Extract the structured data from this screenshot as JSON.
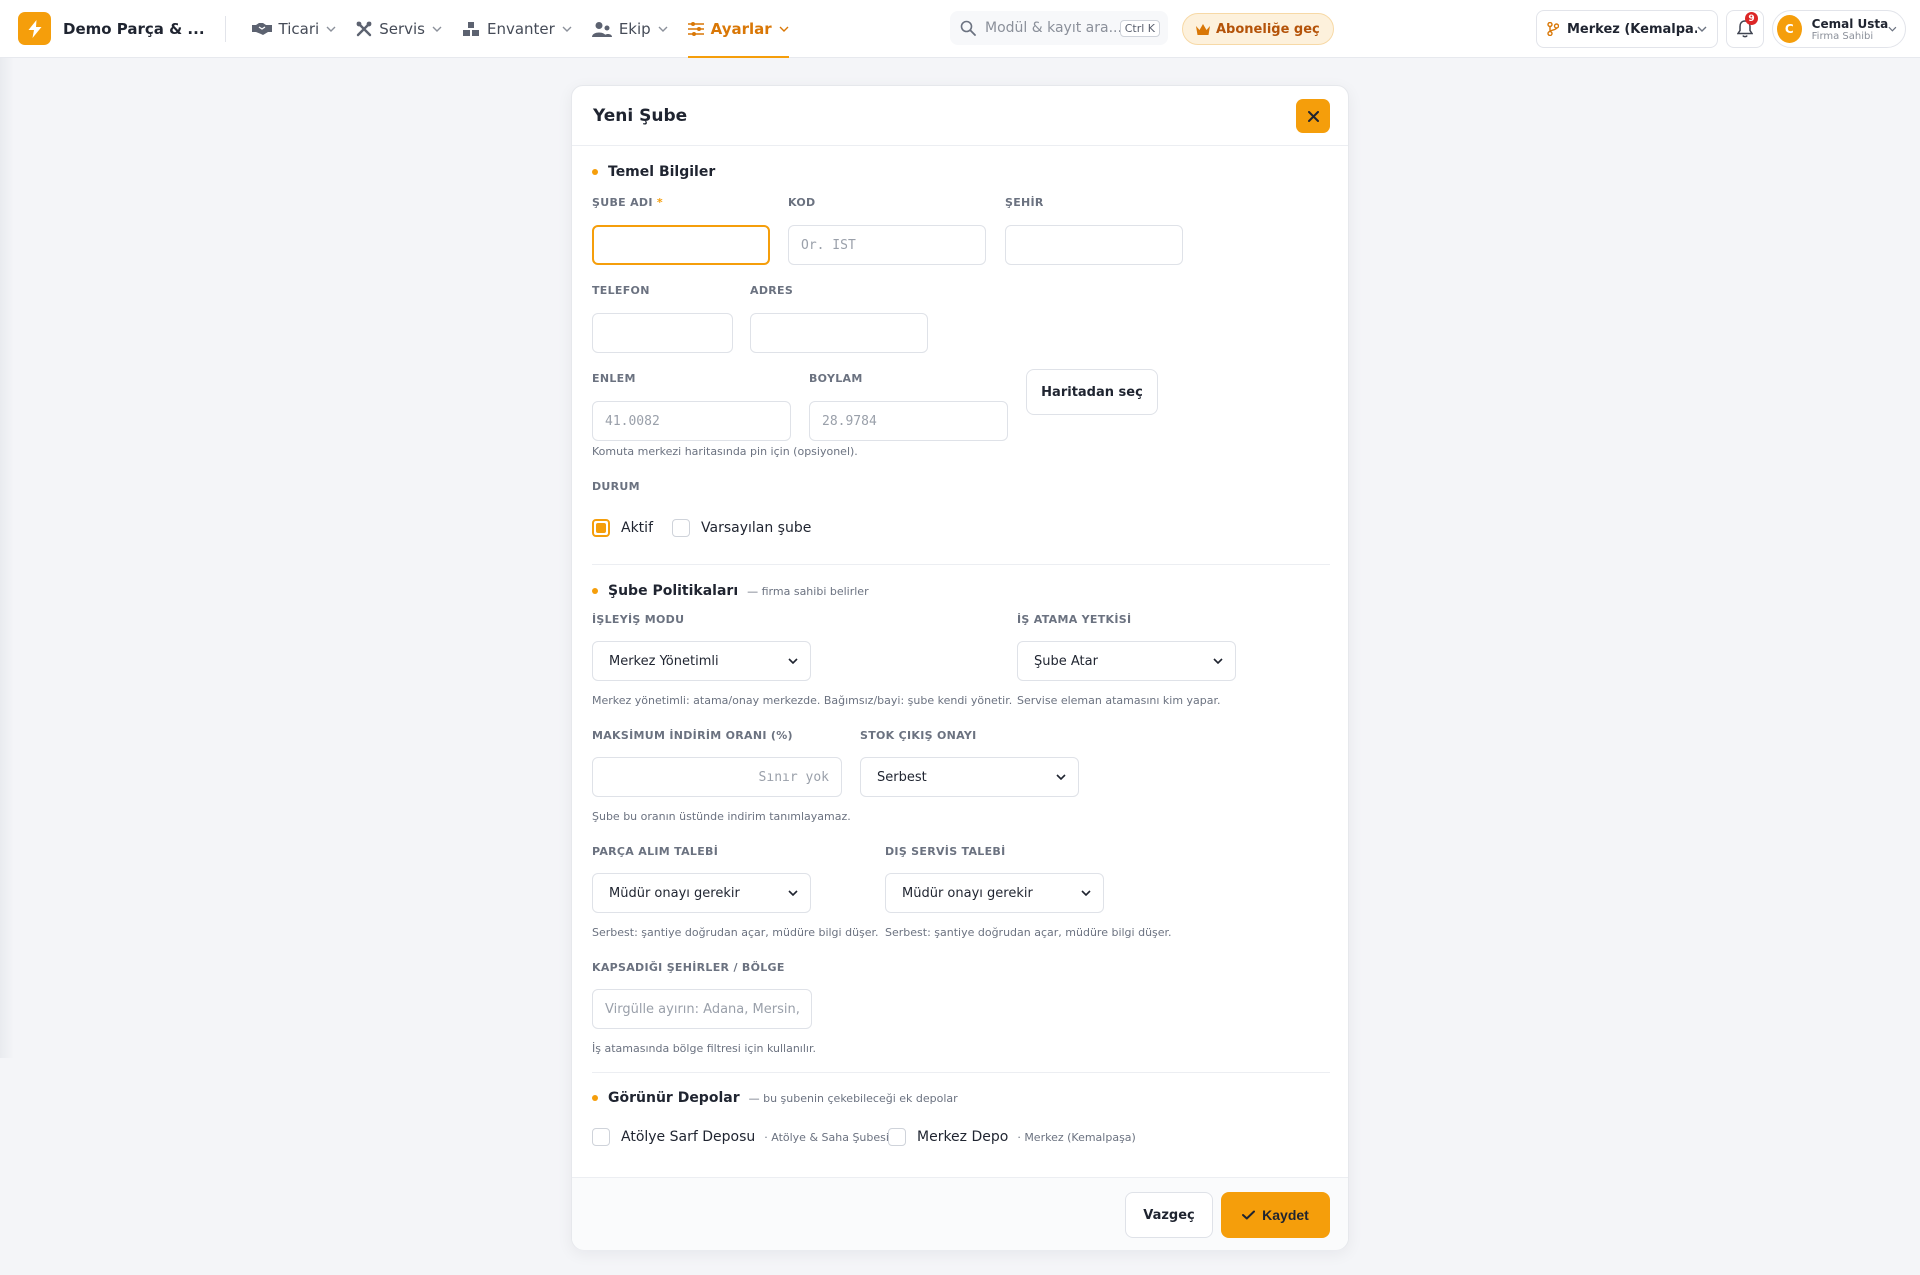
{
  "brand": {
    "name": "Demo Parça & ..."
  },
  "nav": [
    {
      "label": "Ticari",
      "icon": "handshake-icon"
    },
    {
      "label": "Servis",
      "icon": "tools-icon"
    },
    {
      "label": "Envanter",
      "icon": "warehouse-icon"
    },
    {
      "label": "Ekip",
      "icon": "team-icon"
    },
    {
      "label": "Ayarlar",
      "icon": "sliders-icon",
      "active": true
    }
  ],
  "search": {
    "placeholder": "Modül & kayıt ara...",
    "shortcut": "Ctrl K"
  },
  "subscribe": {
    "label": "Aboneliğe geç"
  },
  "branch": {
    "label": "Merkez (Kemalpa..."
  },
  "notifications": {
    "count": "9"
  },
  "user": {
    "initial": "C",
    "name": "Cemal Usta",
    "role": "Firma Sahibi"
  },
  "modal": {
    "title": "Yeni Şube",
    "basic": {
      "title": "Temel Bilgiler",
      "branch_name_label": "ŞUBE ADI",
      "branch_name_required": "*",
      "branch_name_value": "",
      "code_label": "KOD",
      "code_placeholder": "Ör. IST",
      "city_label": "ŞEHİR",
      "city_value": "",
      "phone_label": "TELEFON",
      "phone_value": "",
      "address_label": "ADRES",
      "address_value": "",
      "lat_label": "ENLEM",
      "lat_placeholder": "41.0082",
      "lng_label": "BOYLAM",
      "lng_placeholder": "28.9784",
      "map_button": "Haritadan seç",
      "coords_hint": "Komuta merkezi haritasında pin için (opsiyonel).",
      "status_label": "DURUM",
      "active_label": "Aktif",
      "active_checked": true,
      "default_label": "Varsayılan şube",
      "default_checked": false
    },
    "policies": {
      "title": "Şube Politikaları",
      "subtitle": "— firma sahibi belirler",
      "operation_mode_label": "İŞLEYİŞ MODU",
      "operation_mode_value": "Merkez Yönetimli",
      "operation_mode_hint": "Merkez yönetimli: atama/onay merkezde. Bağımsız/bayi: şube kendi yönetir.",
      "assign_label": "İŞ ATAMA YETKİSİ",
      "assign_value": "Şube Atar",
      "assign_hint": "Servise eleman atamasını kim yapar.",
      "max_discount_label": "MAKSİMUM İNDİRİM ORANI (%)",
      "max_discount_placeholder": "Sınır yok",
      "max_discount_hint": "Şube bu oranın üstünde indirim tanımlayamaz.",
      "stock_out_label": "STOK ÇIKIŞ ONAYI",
      "stock_out_value": "Serbest",
      "part_request_label": "PARÇA ALIM TALEBİ",
      "part_request_value": "Müdür onayı gerekir",
      "part_request_hint": "Serbest: şantiye doğrudan açar, müdüre bilgi düşer.",
      "external_service_label": "DIŞ SERVİS TALEBİ",
      "external_service_value": "Müdür onayı gerekir",
      "external_service_hint": "Serbest: şantiye doğrudan açar, müdüre bilgi düşer.",
      "regions_label": "KAPSADIĞI ŞEHİRLER / BÖLGE",
      "regions_placeholder": "Virgülle ayırın: Adana, Mersin, Hatay",
      "regions_hint": "İş atamasında bölge filtresi için kullanılır."
    },
    "warehouses": {
      "title": "Görünür Depolar",
      "subtitle": "— bu şubenin çekebileceği ek depolar",
      "items": [
        {
          "name": "Atölye Sarf Deposu",
          "branch": "· Atölye & Saha Şubesi",
          "checked": false
        },
        {
          "name": "Merkez Depo",
          "branch": "· Merkez (Kemalpaşa)",
          "checked": false
        }
      ]
    },
    "footer": {
      "cancel": "Vazgeç",
      "save": "Kaydet"
    }
  },
  "colors": {
    "accent": "#f59e0b",
    "accent_dark": "#d97706",
    "badge": "#dc2626"
  }
}
